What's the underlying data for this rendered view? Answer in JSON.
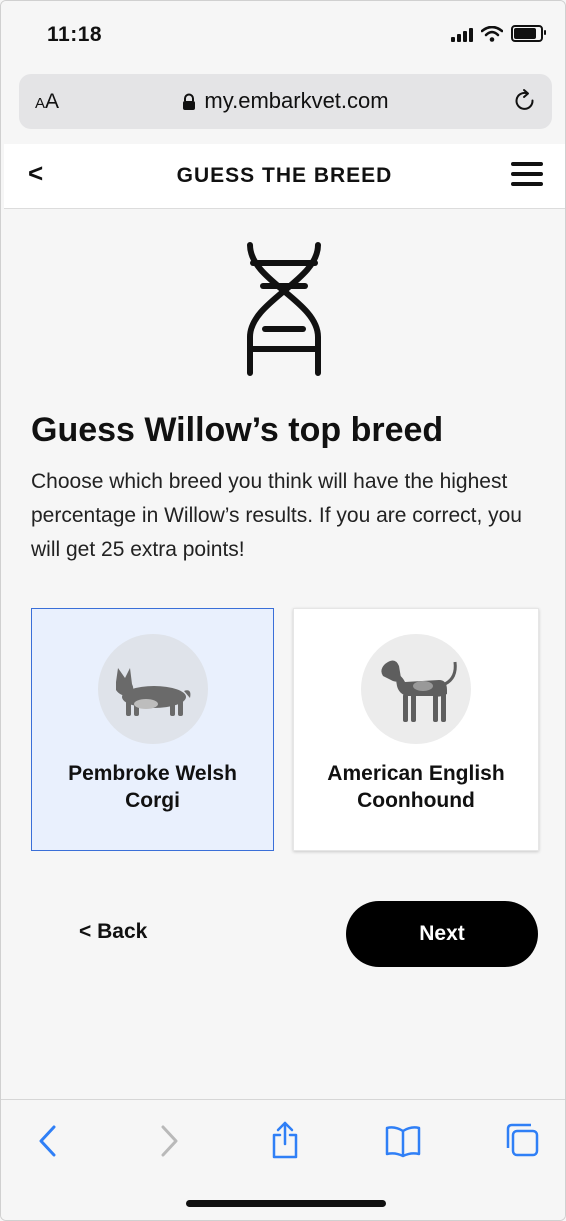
{
  "status_bar": {
    "time": "11:18",
    "battery_level": 0.8
  },
  "browser": {
    "text_size_label_small": "A",
    "text_size_label_large": "A",
    "url": "my.embarkvet.com"
  },
  "header": {
    "back_label": "<",
    "title": "GUESS THE BREED"
  },
  "main": {
    "heading": "Guess Willow’s top breed",
    "description": "Choose which breed you think will have the highest percentage in Willow’s results. If you are correct, you will get 25 extra points!"
  },
  "options": [
    {
      "name": "Pembroke Welsh Corgi",
      "selected": true
    },
    {
      "name": "American English Coonhound",
      "selected": false
    }
  ],
  "actions": {
    "back_label": "< Back",
    "next_label": "Next"
  },
  "colors": {
    "accent": "#3a6fd8",
    "selected_bg": "#e9f0fd",
    "ios_blue": "#2f7ff6"
  }
}
